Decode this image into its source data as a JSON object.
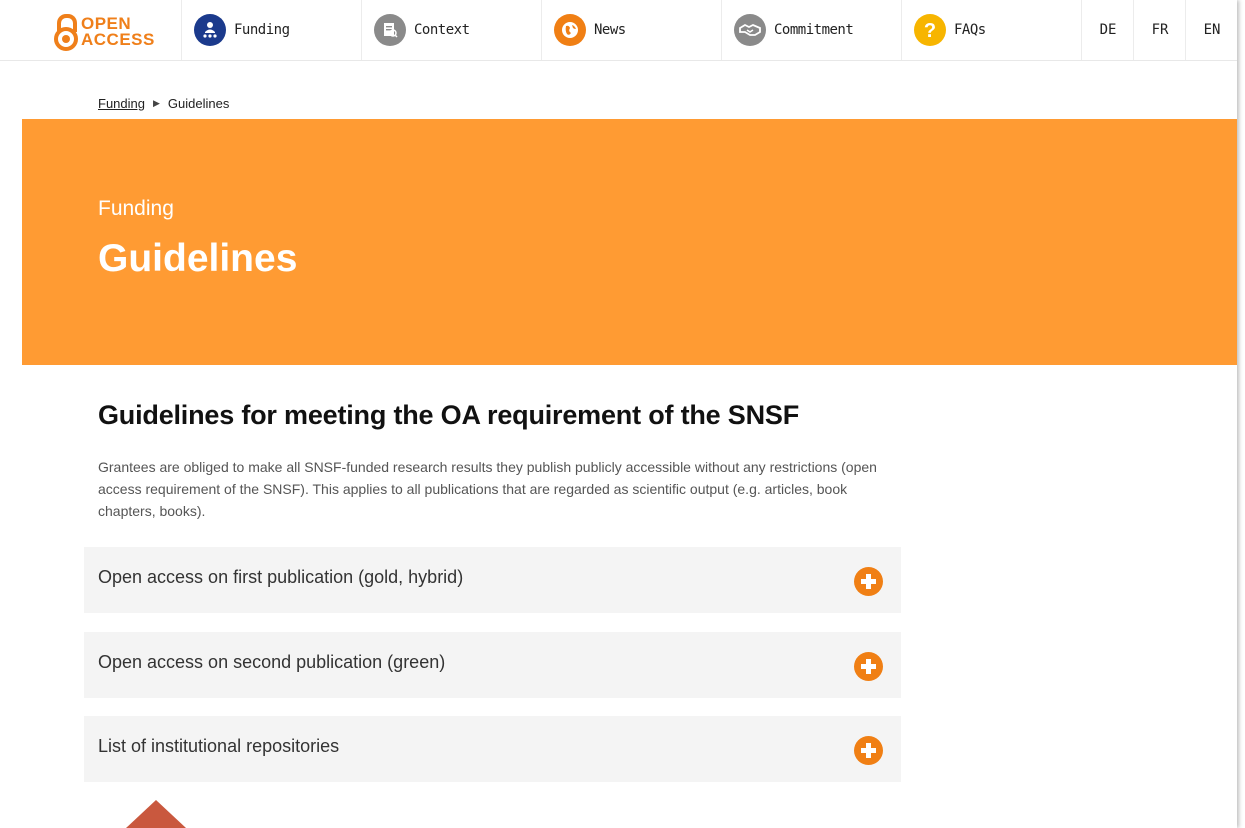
{
  "logo": {
    "line1": "OPEN",
    "line2": "ACCESS"
  },
  "nav": [
    {
      "label": "Funding",
      "icon": "funding-icon",
      "color": "#1b3a8c"
    },
    {
      "label": "Context",
      "icon": "document-icon",
      "color": "#8a8a8a"
    },
    {
      "label": "News",
      "icon": "globe-icon",
      "color": "#f07f14"
    },
    {
      "label": "Commitment",
      "icon": "handshake-icon",
      "color": "#8a8a8a"
    },
    {
      "label": "FAQs",
      "icon": "question-icon",
      "color": "#f7b500"
    }
  ],
  "languages": [
    "DE",
    "FR",
    "EN"
  ],
  "breadcrumb": {
    "parent": "Funding",
    "current": "Guidelines"
  },
  "hero": {
    "kicker": "Funding",
    "title": "Guidelines",
    "color": "#ff9b33"
  },
  "content": {
    "title": "Guidelines for meeting the OA requirement of the SNSF",
    "intro": "Grantees are obliged to make all SNSF-funded research results they publish publicly accessible without any restrictions (open access requirement of the SNSF). This applies to all publications that are regarded as scientific output (e.g. articles, book chapters, books)."
  },
  "accordion": [
    {
      "label": "Open access on first publication (gold, hybrid)"
    },
    {
      "label": "Open access on second publication (green)"
    },
    {
      "label": "List of institutional repositories"
    }
  ],
  "accent": "#f07f14",
  "scroll_top_color": "#c9583e"
}
